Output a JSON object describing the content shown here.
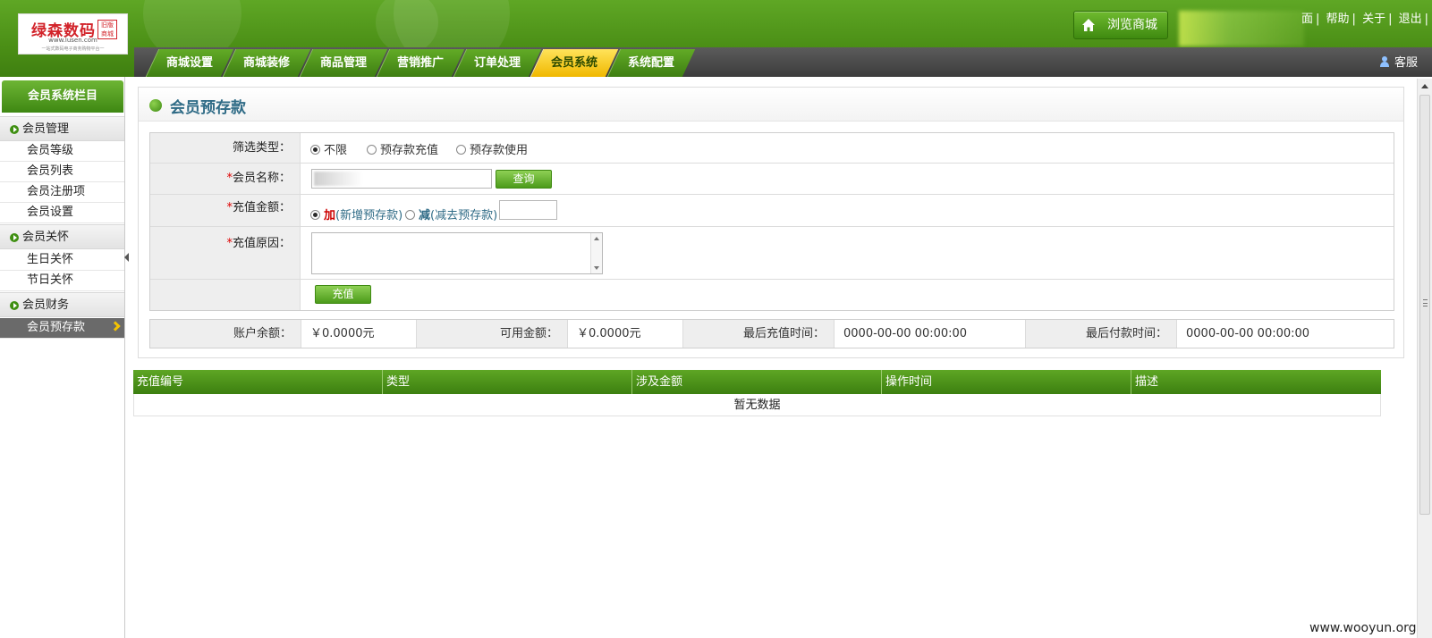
{
  "header": {
    "logo": {
      "brand": "绿森数码",
      "tag": "旧版商城",
      "url": "www.lusen.com",
      "slogan": "一站式数码电子商务购物平台一"
    },
    "browse_label": "浏览商城",
    "top_links": [
      "面",
      "帮助",
      "关于",
      "退出"
    ],
    "service_label": "客服"
  },
  "nav": {
    "items": [
      {
        "label": "商城设置"
      },
      {
        "label": "商城装修"
      },
      {
        "label": "商品管理"
      },
      {
        "label": "营销推广"
      },
      {
        "label": "订单处理"
      },
      {
        "label": "会员系统"
      },
      {
        "label": "系统配置"
      }
    ],
    "active": "会员系统"
  },
  "sidebar": {
    "title": "会员系统栏目",
    "groups": [
      {
        "label": "会员管理",
        "items": [
          "会员等级",
          "会员列表",
          "会员注册项",
          "会员设置"
        ]
      },
      {
        "label": "会员关怀",
        "items": [
          "生日关怀",
          "节日关怀"
        ]
      },
      {
        "label": "会员财务",
        "items": [
          "会员预存款"
        ]
      }
    ],
    "active": "会员预存款"
  },
  "main": {
    "title": "会员预存款",
    "filter": {
      "label": "筛选类型：",
      "options": [
        "不限",
        "预存款充值",
        "预存款使用"
      ],
      "selected": "不限"
    },
    "member": {
      "label": "会员名称：",
      "required": "*",
      "query_button": "查询"
    },
    "amount": {
      "label": "充值金额：",
      "required": "*",
      "add_label": "加",
      "add_desc": "(新增预存款)",
      "sub_label": "减",
      "sub_desc": "(减去预存款)",
      "value": ""
    },
    "reason": {
      "label": "充值原因：",
      "required": "*",
      "value": ""
    },
    "submit_button": "充值",
    "account": {
      "balance_label": "账户余额：",
      "balance": "￥0.0000元",
      "available_label": "可用金额：",
      "available": "￥0.0000元",
      "last_recharge_label": "最后充值时间：",
      "last_recharge": "0000-00-00 00:00:00",
      "last_payment_label": "最后付款时间：",
      "last_payment": "0000-00-00 00:00:00"
    },
    "table": {
      "columns": [
        "充值编号",
        "类型",
        "涉及金额",
        "操作时间",
        "描述"
      ],
      "empty_text": "暂无数据"
    }
  },
  "watermark": "www.wooyun.org",
  "colors": {
    "brand_green": "#4b8f16",
    "active_tab": "#f0b800",
    "title_blue": "#2f6b86"
  }
}
